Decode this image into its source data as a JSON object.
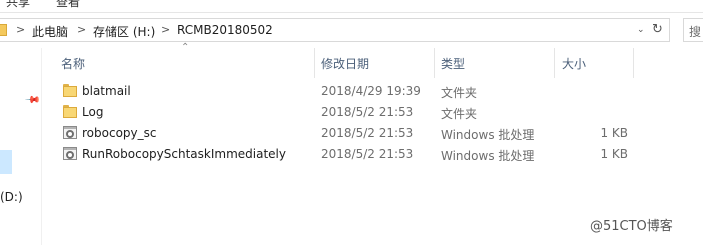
{
  "ribbon": {
    "tabs": [
      "共享",
      "查看"
    ]
  },
  "address": {
    "breadcrumb": [
      "此电脑",
      "存储区 (H:)",
      "RCMB20180502"
    ],
    "separator": ">",
    "dropdown_glyph": "⌄",
    "refresh_glyph": "↻"
  },
  "search": {
    "placeholder": "搜"
  },
  "nav": {
    "drive_label": "(D:)"
  },
  "columns": {
    "name": "名称",
    "date": "修改日期",
    "type": "类型",
    "size": "大小"
  },
  "files": [
    {
      "name": "blatmail",
      "date": "2018/4/29 19:39",
      "type": "文件夹",
      "size": "",
      "icon": "folder-icon"
    },
    {
      "name": "Log",
      "date": "2018/5/2 21:53",
      "type": "文件夹",
      "size": "",
      "icon": "folder-icon"
    },
    {
      "name": "robocopy_sc",
      "date": "2018/5/2 21:53",
      "type": "Windows 批处理",
      "size": "1 KB",
      "icon": "batch-file-icon"
    },
    {
      "name": "RunRobocopySchtaskImmediately",
      "date": "2018/5/2 21:53",
      "type": "Windows 批处理",
      "size": "1 KB",
      "icon": "batch-file-icon"
    }
  ],
  "watermark": "@51CTO博客",
  "colors": {
    "selection": "#cce8ff",
    "folder": "#f8d775",
    "header_text": "#4c607a",
    "secondary_text": "#6d6d6d"
  }
}
